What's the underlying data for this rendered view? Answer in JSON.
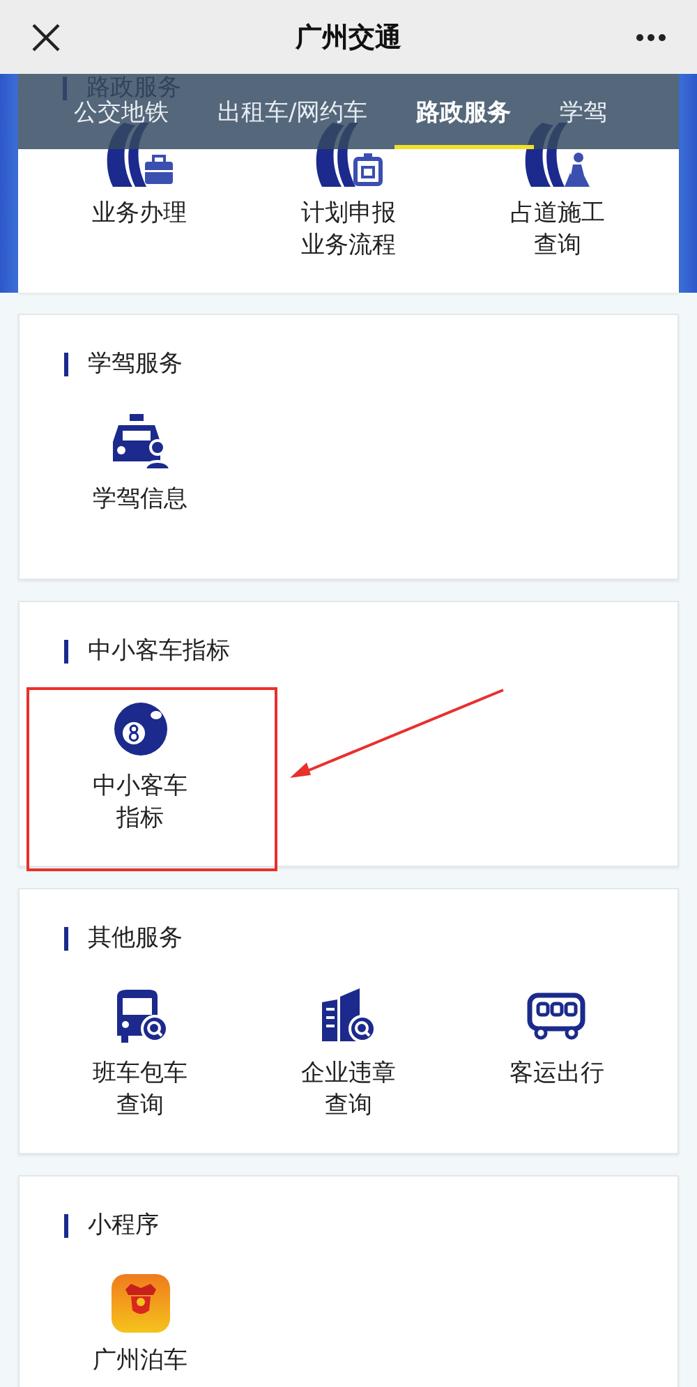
{
  "header": {
    "title": "广州交通"
  },
  "tabs": [
    {
      "label": "公交地铁",
      "selected": false
    },
    {
      "label": "出租车/网约车",
      "selected": false
    },
    {
      "label": "路政服务",
      "selected": true
    },
    {
      "label": "学驾",
      "selected": false
    }
  ],
  "sections": [
    {
      "title": "路政服务",
      "items": [
        {
          "label": "业务办理",
          "kind": "briefcase"
        },
        {
          "label": "计划申报业务流程",
          "kind": "clipboard"
        },
        {
          "label": "占道施工查询",
          "kind": "worker"
        }
      ]
    },
    {
      "title": "学驾服务",
      "items": [
        {
          "label": "学驾信息",
          "kind": "taxi"
        }
      ]
    },
    {
      "title": "中小客车指标",
      "highlighted": true,
      "items": [
        {
          "label": "中小客车指标",
          "kind": "ball"
        }
      ]
    },
    {
      "title": "其他服务",
      "items": [
        {
          "label": "班车包车查询",
          "kind": "coach"
        },
        {
          "label": "企业违章查询",
          "kind": "building"
        },
        {
          "label": "客运出行",
          "kind": "bus"
        }
      ]
    },
    {
      "title": "小程序",
      "items": [
        {
          "label": "广州泊车",
          "kind": "app"
        }
      ]
    }
  ]
}
